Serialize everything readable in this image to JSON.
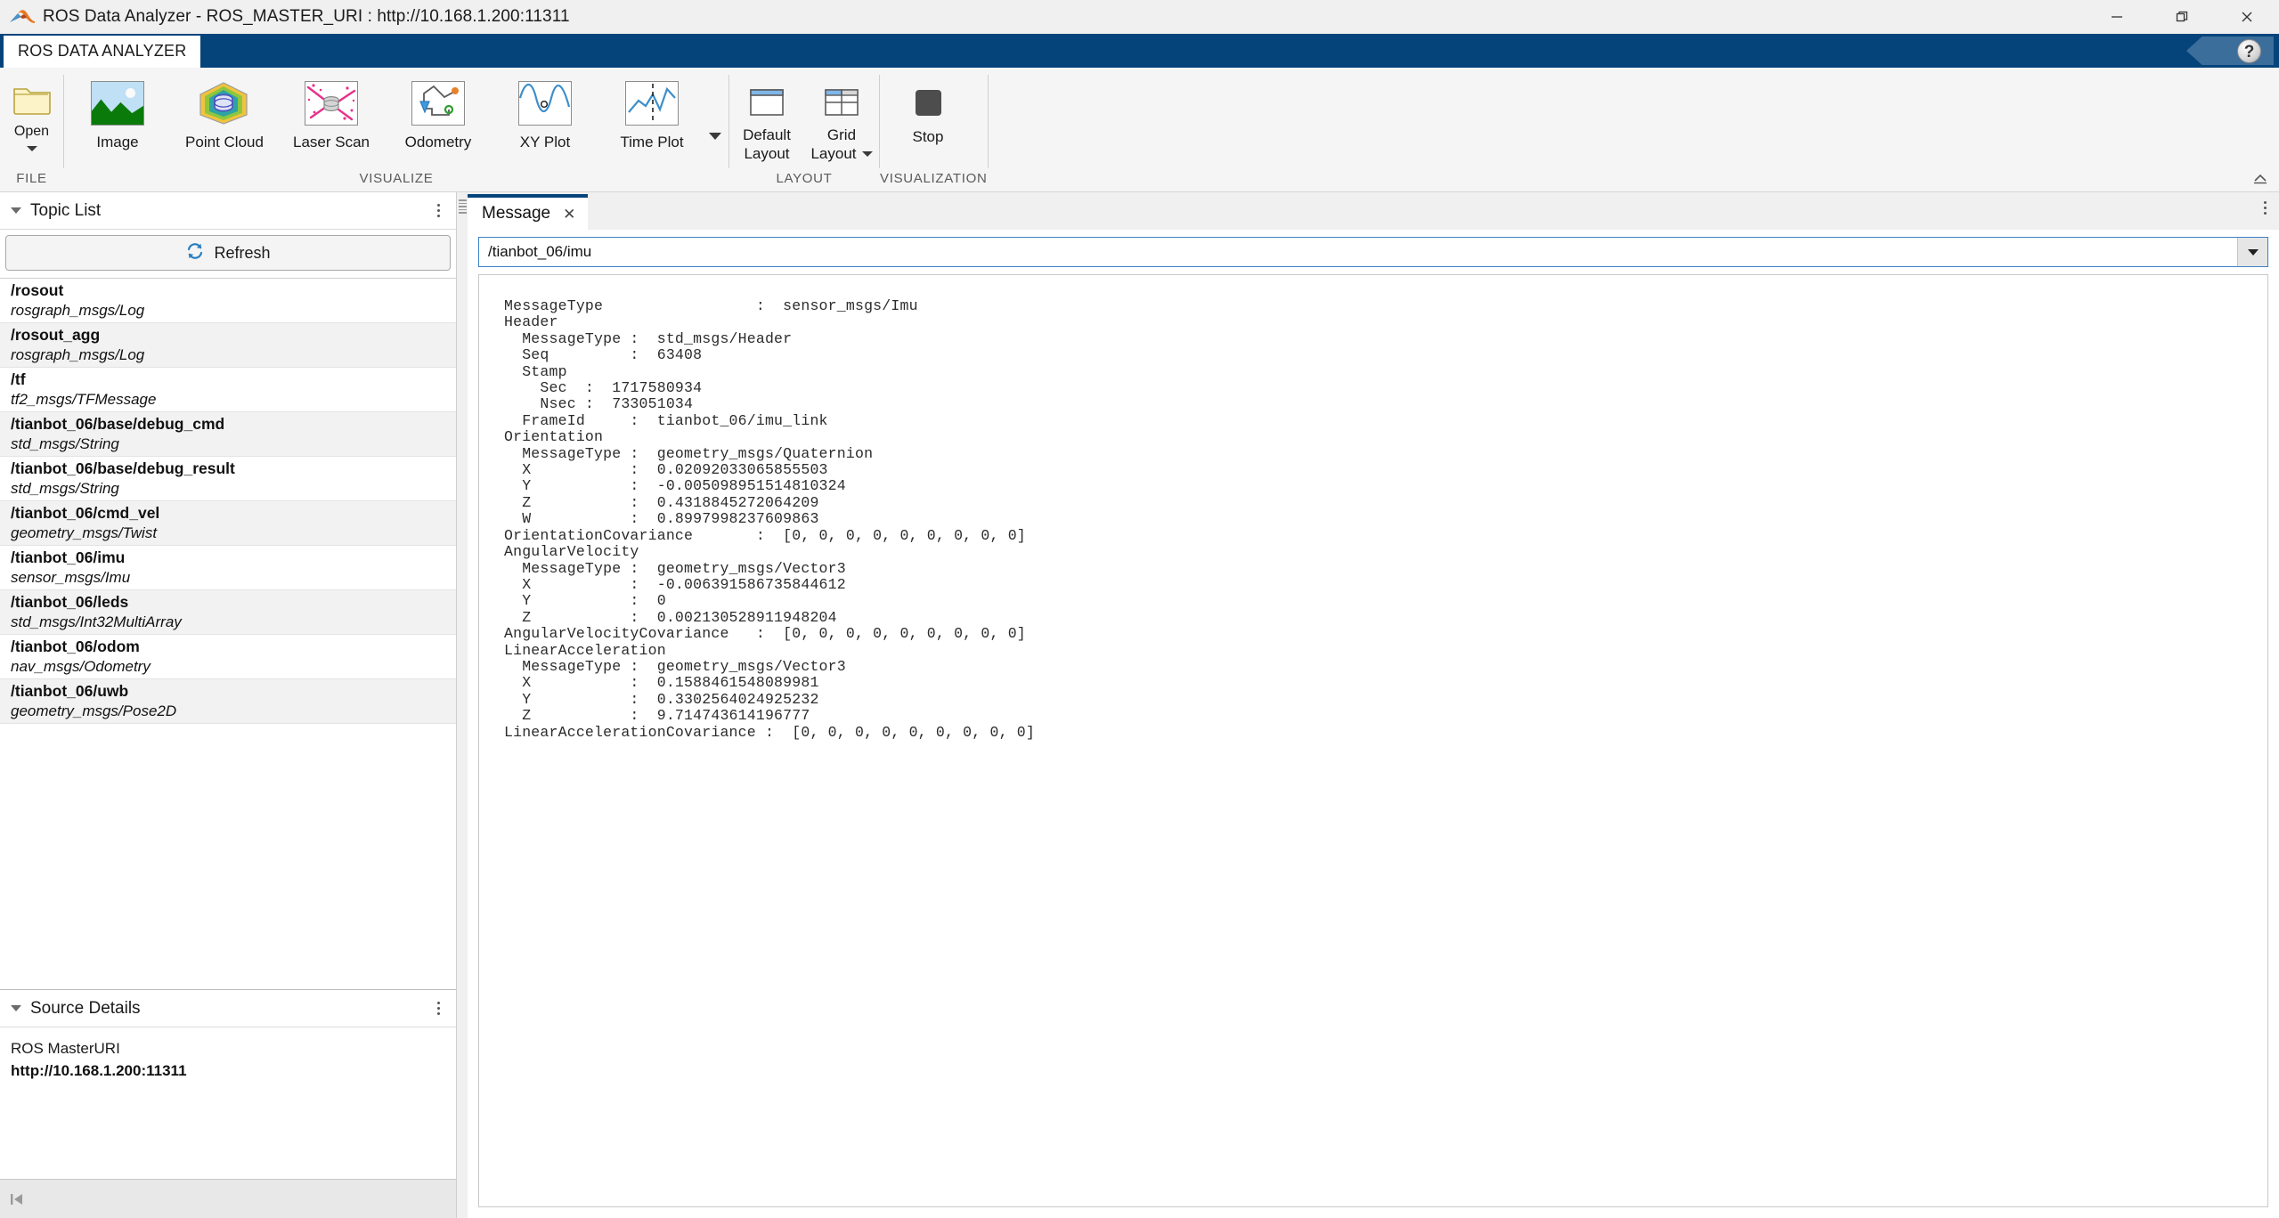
{
  "window": {
    "title": "ROS Data Analyzer - ROS_MASTER_URI : http://10.168.1.200:11311",
    "app_icon": "matlab-membrane-icon",
    "minimize_label": "—",
    "restore_label": "restore-icon",
    "close_label": "✕"
  },
  "ribbon": {
    "tab_label": "ROS DATA ANALYZER",
    "help_label": "?",
    "groups": {
      "file": {
        "label": "FILE",
        "open_button": {
          "label": "Open",
          "icon": "open-folder-icon",
          "has_menu": true
        }
      },
      "visualize": {
        "label": "VISUALIZE",
        "buttons": [
          {
            "label": "Image",
            "icon": "image-thumbnail-icon"
          },
          {
            "label": "Point Cloud",
            "icon": "point-cloud-icon"
          },
          {
            "label": "Laser Scan",
            "icon": "laser-scan-icon"
          },
          {
            "label": "Odometry",
            "icon": "odometry-icon"
          },
          {
            "label": "XY Plot",
            "icon": "xy-plot-icon"
          },
          {
            "label": "Time Plot",
            "icon": "time-plot-icon"
          }
        ],
        "overflow_label": "more-visualizations-caret"
      },
      "layout": {
        "label": "LAYOUT",
        "buttons": [
          {
            "label_line1": "Default",
            "label_line2": "Layout",
            "icon": "default-layout-icon",
            "has_menu": false
          },
          {
            "label_line1": "Grid",
            "label_line2": "Layout",
            "icon": "grid-layout-icon",
            "has_menu": true
          }
        ]
      },
      "visualization": {
        "label": "VISUALIZATION",
        "stop_button": {
          "label": "Stop",
          "icon": "stop-square-icon"
        }
      }
    }
  },
  "sidebar": {
    "topic_list": {
      "title": "Topic List",
      "refresh_label": "Refresh",
      "refresh_icon": "refresh-icon",
      "kebab_icon": "more-options-icon",
      "items": [
        {
          "name": "/rosout",
          "type": "rosgraph_msgs/Log"
        },
        {
          "name": "/rosout_agg",
          "type": "rosgraph_msgs/Log"
        },
        {
          "name": "/tf",
          "type": "tf2_msgs/TFMessage"
        },
        {
          "name": "/tianbot_06/base/debug_cmd",
          "type": "std_msgs/String"
        },
        {
          "name": "/tianbot_06/base/debug_result",
          "type": "std_msgs/String"
        },
        {
          "name": "/tianbot_06/cmd_vel",
          "type": "geometry_msgs/Twist"
        },
        {
          "name": "/tianbot_06/imu",
          "type": "sensor_msgs/Imu"
        },
        {
          "name": "/tianbot_06/leds",
          "type": "std_msgs/Int32MultiArray"
        },
        {
          "name": "/tianbot_06/odom",
          "type": "nav_msgs/Odometry"
        },
        {
          "name": "/tianbot_06/uwb",
          "type": "geometry_msgs/Pose2D"
        }
      ]
    },
    "source_details": {
      "title": "Source Details",
      "kebab_icon": "more-options-icon",
      "key": "ROS MasterURI",
      "value": "http://10.168.1.200:11311"
    },
    "statusbar": {
      "nav_icon": "go-to-first-icon"
    }
  },
  "document": {
    "tab": {
      "label": "Message",
      "close_icon": "close-icon"
    },
    "kebab_icon": "more-options-icon",
    "topic_select": {
      "value": "/tianbot_06/imu",
      "placeholder": "/tianbot_06/imu",
      "arrow_icon": "chevron-down-icon"
    },
    "message": {
      "message_type": "sensor_msgs/Imu",
      "header": {
        "message_type": "std_msgs/Header",
        "seq": "63408",
        "stamp": {
          "sec": "1717580934",
          "nsec": "733051034"
        },
        "frame_id": "tianbot_06/imu_link"
      },
      "orientation": {
        "message_type": "geometry_msgs/Quaternion",
        "x": "0.02092033065855503",
        "y": "-0.005098951514810324",
        "z": "0.4318845272064209",
        "w": "0.8997998237609863"
      },
      "orientation_covariance": "[0, 0, 0, 0, 0, 0, 0, 0, 0]",
      "angular_velocity": {
        "message_type": "geometry_msgs/Vector3",
        "x": "-0.006391586735844612",
        "y": "0",
        "z": "0.002130528911948204"
      },
      "angular_velocity_covariance": "[0, 0, 0, 0, 0, 0, 0, 0, 0]",
      "linear_acceleration": {
        "message_type": "geometry_msgs/Vector3",
        "x": "0.1588461548089981",
        "y": "0.3302564024925232",
        "z": "9.714743614196777"
      },
      "linear_acceleration_covariance": "[0, 0, 0, 0, 0, 0, 0, 0, 0]",
      "text": "MessageType                 :  sensor_msgs/Imu\nHeader\n  MessageType :  std_msgs/Header\n  Seq         :  63408\n  Stamp\n    Sec  :  1717580934\n    Nsec :  733051034\n  FrameId     :  tianbot_06/imu_link\nOrientation\n  MessageType :  geometry_msgs/Quaternion\n  X           :  0.02092033065855503\n  Y           :  -0.005098951514810324\n  Z           :  0.4318845272064209\n  W           :  0.8997998237609863\nOrientationCovariance       :  [0, 0, 0, 0, 0, 0, 0, 0, 0]\nAngularVelocity\n  MessageType :  geometry_msgs/Vector3\n  X           :  -0.006391586735844612\n  Y           :  0\n  Z           :  0.002130528911948204\nAngularVelocityCovariance   :  [0, 0, 0, 0, 0, 0, 0, 0, 0]\nLinearAcceleration\n  MessageType :  geometry_msgs/Vector3\n  X           :  0.1588461548089981\n  Y           :  0.3302564024925232\n  Z           :  9.714743614196777\nLinearAccelerationCovariance :  [0, 0, 0, 0, 0, 0, 0, 0, 0]"
    }
  },
  "colors": {
    "ribbon_blue": "#05447b",
    "accent_blue": "#3c82c4",
    "panel_bg": "#f0f0f0",
    "alt_row": "#f2f2f2"
  }
}
